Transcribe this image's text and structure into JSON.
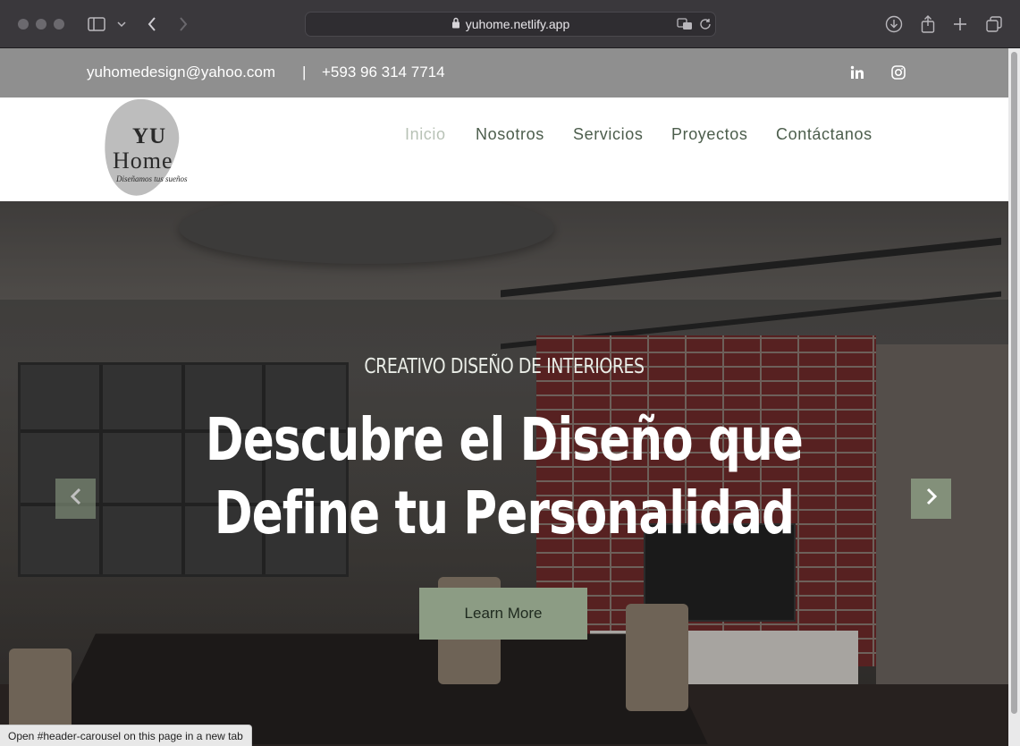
{
  "browser": {
    "url": "yuhome.netlify.app",
    "status_link": "Open #header-carousel on this page in a new tab"
  },
  "topbar": {
    "email": "yuhomedesign@yahoo.com",
    "separator": "|",
    "phone": "+593 96 314 7714",
    "social": [
      "linkedin-icon",
      "instagram-icon"
    ]
  },
  "logo": {
    "line1": "YU",
    "line2": "Home",
    "tagline": "Diseñamos tus sueños"
  },
  "nav": {
    "items": [
      {
        "label": "Inicio",
        "active": true
      },
      {
        "label": "Nosotros",
        "active": false
      },
      {
        "label": "Servicios",
        "active": false
      },
      {
        "label": "Proyectos",
        "active": false
      },
      {
        "label": "Contáctanos",
        "active": false
      }
    ]
  },
  "hero": {
    "subtitle": "CREATIVO DISEÑO DE INTERIORES",
    "title_line1": "Descubre el Diseño que",
    "title_line2": "Define tu Personalidad",
    "button_label": "Learn More"
  },
  "colors": {
    "topbar_bg": "#8f8f8f",
    "accent": "#8c9c84",
    "nav_text": "#4c5d4c",
    "nav_active": "#b8c2b6"
  }
}
